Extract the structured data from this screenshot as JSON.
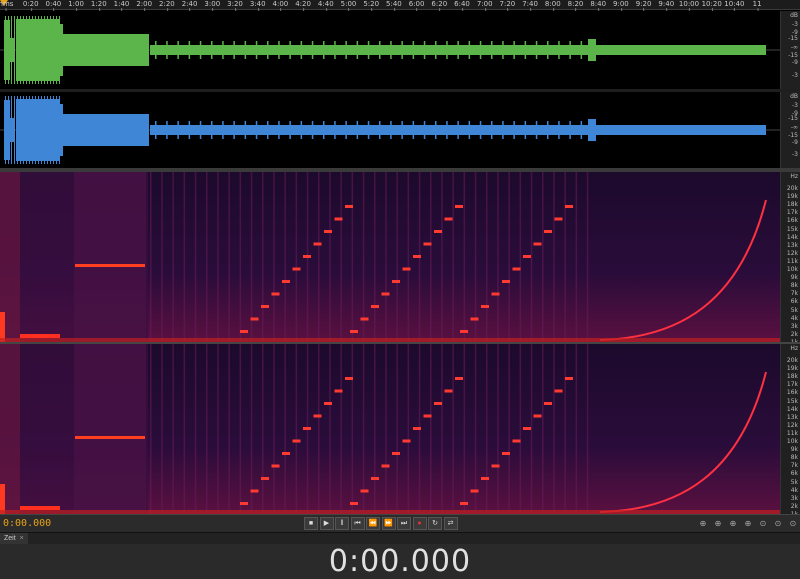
{
  "ruler": {
    "ticks": [
      "hms",
      "0:20",
      "0:40",
      "1:00",
      "1:20",
      "1:40",
      "2:00",
      "2:20",
      "2:40",
      "3:00",
      "3:20",
      "3:40",
      "4:00",
      "4:20",
      "4:40",
      "5:00",
      "5:20",
      "5:40",
      "6:00",
      "6:20",
      "6:40",
      "7:00",
      "7:20",
      "7:40",
      "8:00",
      "8:20",
      "8:40",
      "9:00",
      "9:20",
      "9:40",
      "10:00",
      "10:20",
      "10:40",
      "11"
    ]
  },
  "waveform": {
    "channel_top": {
      "color": "#5cb54a",
      "scale": [
        "dB",
        "-3",
        "-9",
        "-15",
        "-∞",
        "-15",
        "-9",
        "-3"
      ]
    },
    "channel_bottom": {
      "color": "#3f86d6",
      "scale": [
        "dB",
        "-3",
        "-9",
        "-15",
        "-∞",
        "-15",
        "-9",
        "-3"
      ]
    }
  },
  "spectral": {
    "scale_unit": "Hz",
    "scale_labels": [
      "20k",
      "19k",
      "18k",
      "17k",
      "16k",
      "15k",
      "14k",
      "13k",
      "12k",
      "11k",
      "10k",
      "9k",
      "8k",
      "7k",
      "6k",
      "5k",
      "4k",
      "3k",
      "2k",
      "1k"
    ]
  },
  "transport": {
    "current_time": "0:00.000",
    "buttons": [
      {
        "name": "stop-button",
        "glyph": "■"
      },
      {
        "name": "play-button",
        "glyph": "▶"
      },
      {
        "name": "pause-button",
        "glyph": "‖"
      },
      {
        "name": "go-to-start-button",
        "glyph": "⏮"
      },
      {
        "name": "rewind-button",
        "glyph": "⏪"
      },
      {
        "name": "fast-forward-button",
        "glyph": "⏩"
      },
      {
        "name": "go-to-end-button",
        "glyph": "⏭"
      },
      {
        "name": "record-button",
        "glyph": "●"
      },
      {
        "name": "loop-button",
        "glyph": "↻"
      },
      {
        "name": "skip-selection-button",
        "glyph": "⇄"
      }
    ],
    "zoom_buttons": [
      "zoom-in-amplitude-icon",
      "zoom-out-amplitude-icon",
      "zoom-in-time-icon",
      "zoom-out-time-icon",
      "zoom-full-icon",
      "zoom-selection-icon",
      "zoom-in-out-icon"
    ]
  },
  "time_panel": {
    "tab_label": "Zeit",
    "tab_close": "×",
    "time_display": "0:00.000"
  }
}
